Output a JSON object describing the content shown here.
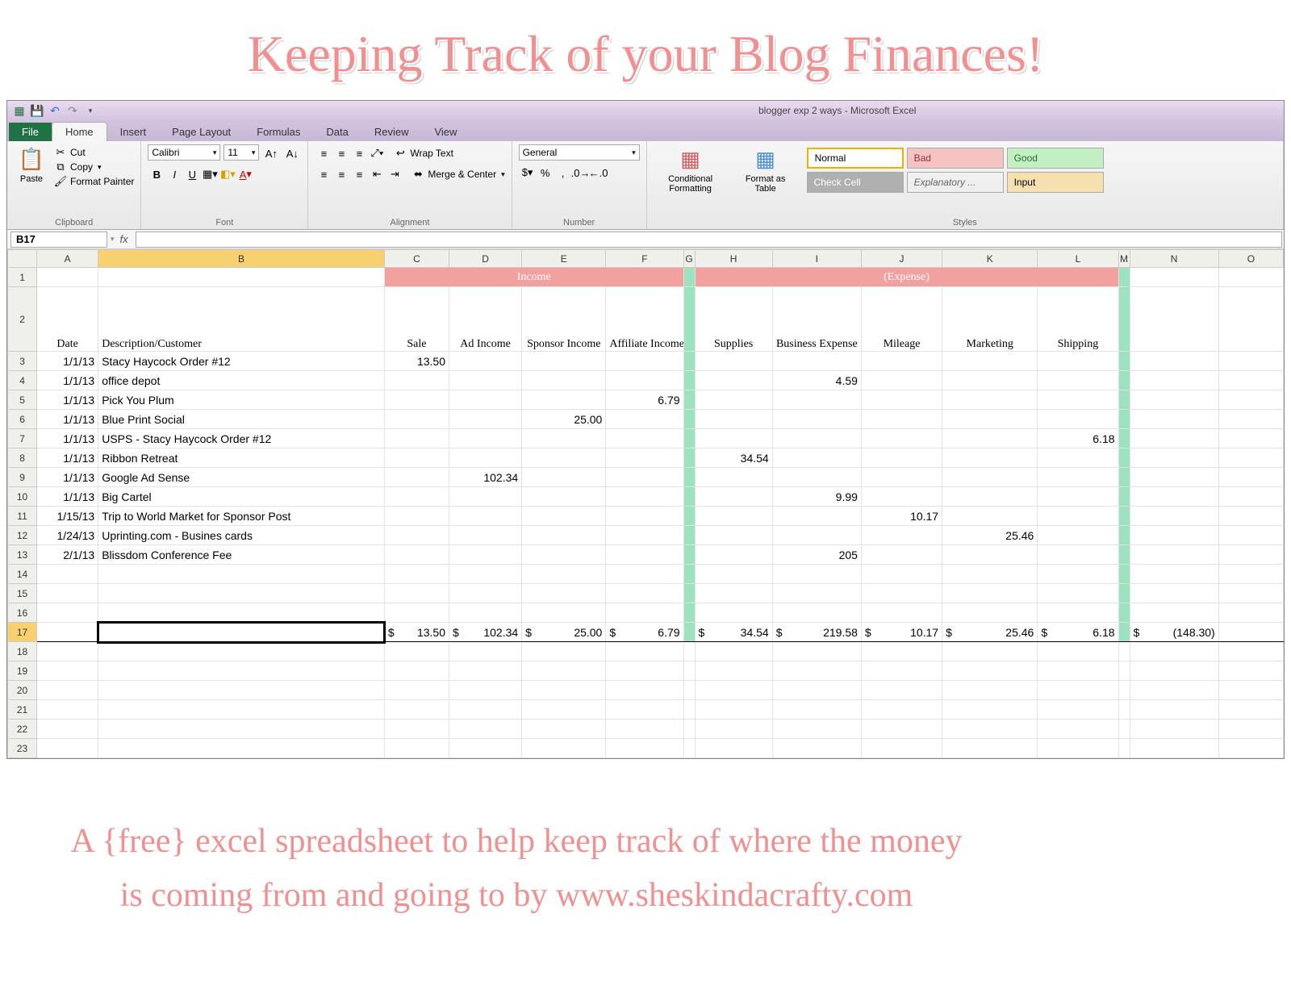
{
  "hero_title": "Keeping Track of your Blog Finances!",
  "hero_subtitle": "A {free} excel spreadsheet to help keep track of where the money is coming from and going to by www.sheskindacrafty.com",
  "window": {
    "title": "blogger exp 2 ways  -  Microsoft Excel"
  },
  "ribbon": {
    "tabs": [
      "File",
      "Home",
      "Insert",
      "Page Layout",
      "Formulas",
      "Data",
      "Review",
      "View"
    ],
    "active_tab": "Home",
    "clipboard": {
      "paste": "Paste",
      "cut": "Cut",
      "copy": "Copy",
      "painter": "Format Painter",
      "label": "Clipboard"
    },
    "font": {
      "name": "Calibri",
      "size": "11",
      "label": "Font"
    },
    "alignment": {
      "wrap": "Wrap Text",
      "merge": "Merge & Center",
      "label": "Alignment"
    },
    "number": {
      "format": "General",
      "label": "Number"
    },
    "styles": {
      "cond": "Conditional Formatting",
      "table": "Format as Table",
      "list": [
        {
          "name": "Normal",
          "cls": "cs-normal"
        },
        {
          "name": "Bad",
          "cls": "cs-bad"
        },
        {
          "name": "Good",
          "cls": "cs-good"
        },
        {
          "name": "Check Cell",
          "cls": "cs-check"
        },
        {
          "name": "Explanatory ...",
          "cls": "cs-expl"
        },
        {
          "name": "Input",
          "cls": "cs-input"
        }
      ],
      "label": "Styles"
    }
  },
  "namebox": "B17",
  "columns": [
    "A",
    "B",
    "C",
    "D",
    "E",
    "F",
    "G",
    "H",
    "I",
    "J",
    "K",
    "L",
    "M",
    "N",
    "O"
  ],
  "selected_col": "B",
  "selected_row": 17,
  "merges": {
    "income": "Income",
    "expense": "(Expense)"
  },
  "headers": {
    "date": "Date",
    "desc": "Description/Customer",
    "sale": "Sale",
    "ad": "Ad Income",
    "sponsor": "Sponsor Income",
    "affiliate": "Affiliate Income",
    "supplies": "Supplies",
    "bizexp": "Business Expense",
    "mileage": "Mileage",
    "mkt": "Marketing",
    "ship": "Shipping"
  },
  "rows": [
    {
      "n": 3,
      "date": "1/1/13",
      "desc": "Stacy Haycock Order #12",
      "sale": "13.50"
    },
    {
      "n": 4,
      "date": "1/1/13",
      "desc": "office depot",
      "bizexp": "4.59"
    },
    {
      "n": 5,
      "date": "1/1/13",
      "desc": "Pick You Plum",
      "affiliate": "6.79"
    },
    {
      "n": 6,
      "date": "1/1/13",
      "desc": "Blue Print Social",
      "sponsor": "25.00"
    },
    {
      "n": 7,
      "date": "1/1/13",
      "desc": "USPS - Stacy Haycock Order #12",
      "ship": "6.18"
    },
    {
      "n": 8,
      "date": "1/1/13",
      "desc": "Ribbon Retreat",
      "supplies": "34.54"
    },
    {
      "n": 9,
      "date": "1/1/13",
      "desc": "Google Ad Sense",
      "ad": "102.34"
    },
    {
      "n": 10,
      "date": "1/1/13",
      "desc": "Big Cartel",
      "bizexp": "9.99"
    },
    {
      "n": 11,
      "date": "1/15/13",
      "desc": "Trip to World Market for Sponsor Post",
      "mileage": "10.17"
    },
    {
      "n": 12,
      "date": "1/24/13",
      "desc": "Uprinting.com - Busines cards",
      "mkt": "25.46"
    },
    {
      "n": 13,
      "date": "2/1/13",
      "desc": "Blissdom Conference Fee",
      "bizexp": "205"
    }
  ],
  "blank_rows": [
    14,
    15,
    16
  ],
  "totals": {
    "n": 17,
    "sale": "13.50",
    "ad": "102.34",
    "sponsor": "25.00",
    "affiliate": "6.79",
    "supplies": "34.54",
    "bizexp": "219.58",
    "mileage": "10.17",
    "mkt": "25.46",
    "ship": "6.18",
    "net": "(148.30)"
  },
  "after_rows": [
    18,
    19,
    20,
    21,
    22,
    23
  ]
}
